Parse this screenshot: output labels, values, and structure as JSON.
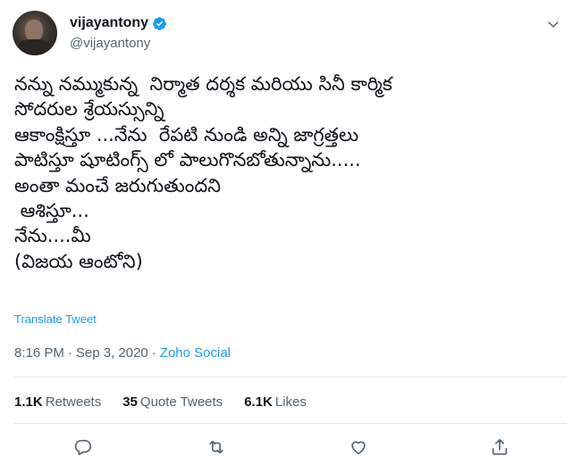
{
  "user": {
    "display_name": "vijayantony",
    "handle": "@vijayantony"
  },
  "tweet": {
    "lines": [
      "నన్ను నమ్ముకున్న  నిర్మాత దర్శక మరియు సినీ కార్మిక",
      "సోదరుల శ్రేయస్సున్ని",
      "ఆకాంక్షిస్తూ ...నేను  రేపటి నుండి అన్ని జాగ్రత్తలు",
      "పాటిస్తూ షూటింగ్స్ లో పాలుగొనబోతున్నాను.....",
      "అంతా మంచే జరుగుతుందని",
      " ఆశిస్తూ...",
      "నేను....మీ",
      "(విజయ ఆంటోని)"
    ],
    "translate_label": "Translate Tweet",
    "time": "8:16 PM",
    "date": "Sep 3, 2020",
    "source": "Zoho Social"
  },
  "stats": {
    "retweets_count": "1.1K",
    "retweets_label": "Retweets",
    "quote_count": "35",
    "quote_label": "Quote Tweets",
    "likes_count": "6.1K",
    "likes_label": "Likes"
  },
  "colors": {
    "link": "#1d9bf0",
    "secondary_text": "#536471",
    "icon": "#536471"
  },
  "icons": {
    "verified": "verified-icon",
    "caret": "chevron-down-icon",
    "reply": "reply-icon",
    "retweet": "retweet-icon",
    "like": "heart-icon",
    "share": "share-icon"
  }
}
